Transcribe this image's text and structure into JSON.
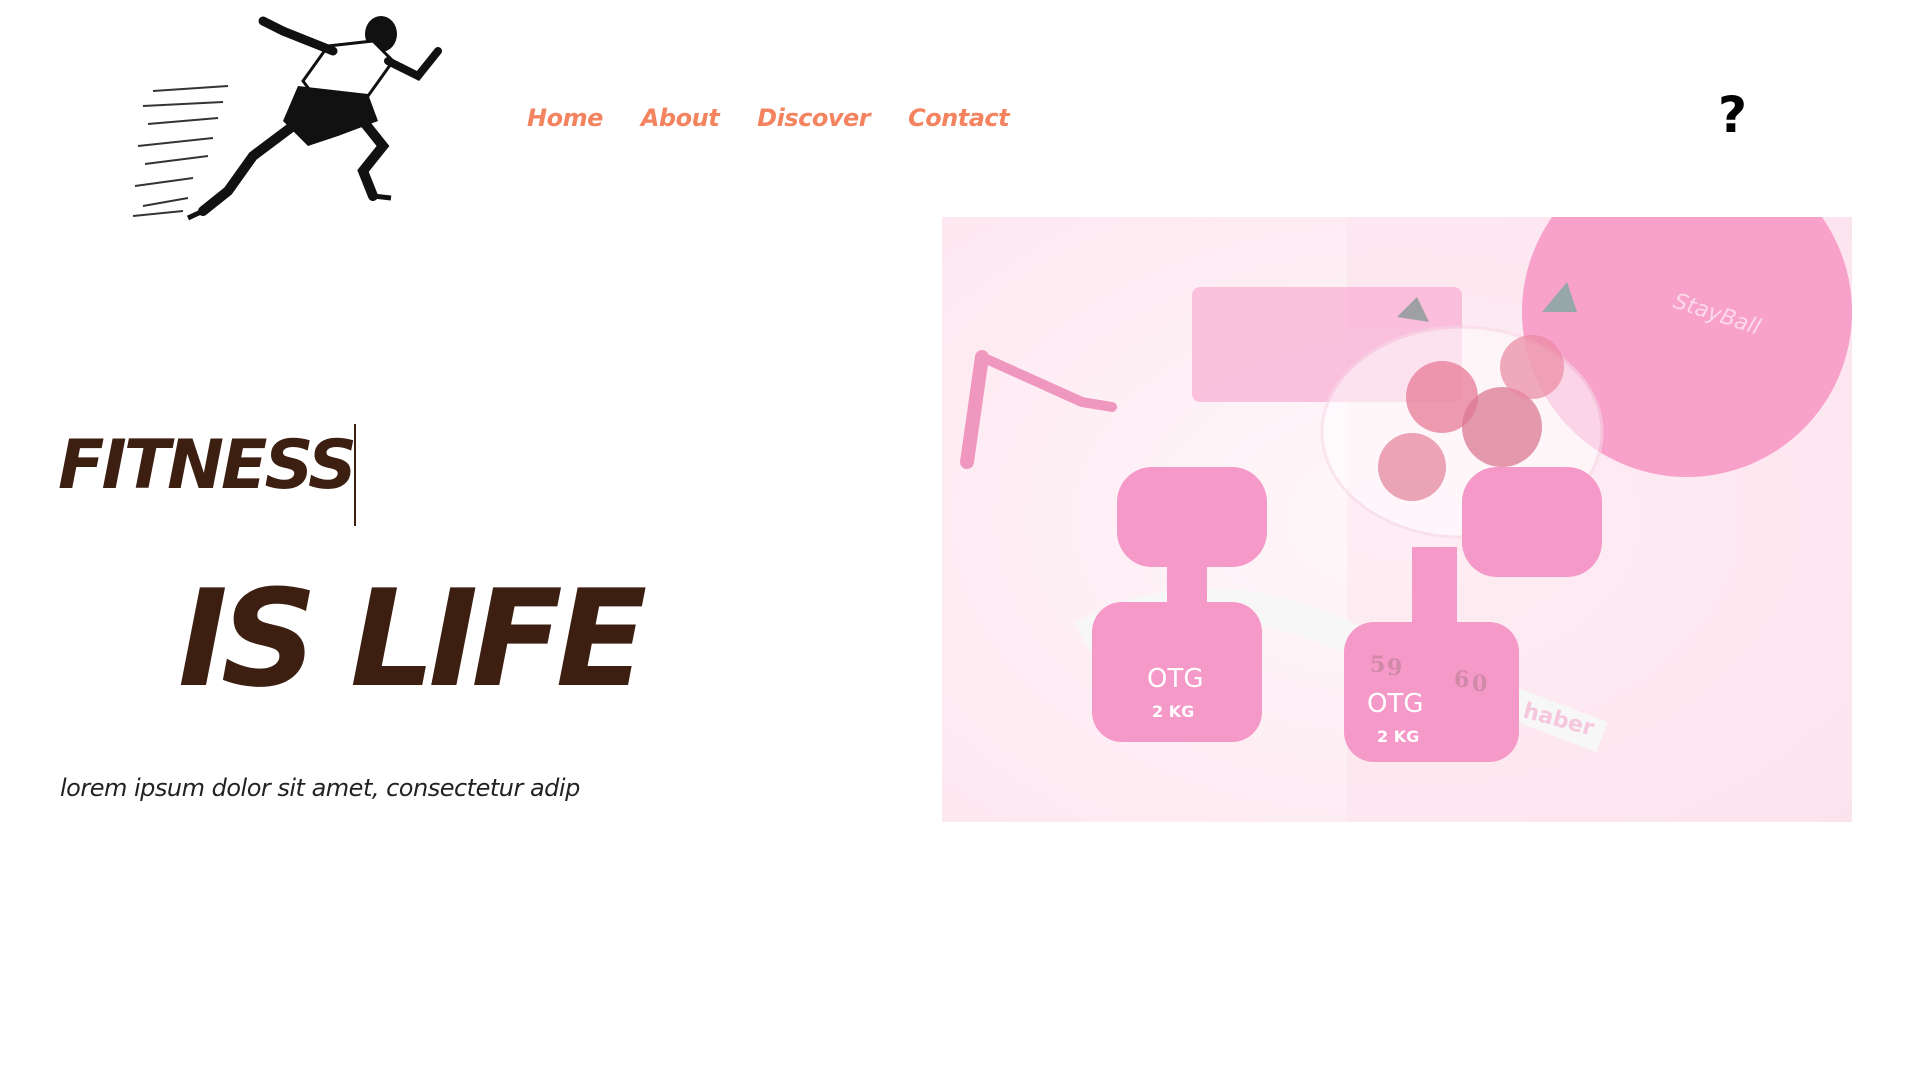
{
  "logo": {
    "icon": "sprinter-logo",
    "alt": "running man"
  },
  "nav": {
    "items": [
      {
        "label": "Home"
      },
      {
        "label": "About"
      },
      {
        "label": "Discover"
      },
      {
        "label": "Contact"
      }
    ],
    "color": "#f4845f"
  },
  "help": {
    "label": "?"
  },
  "hero": {
    "title_line1": "FITNESS",
    "title_line2": "IS LIFE",
    "subtitle": "lorem ipsum dolor sit amet, consectetur adip",
    "title_color": "#3d1f12"
  },
  "image": {
    "icon": "dumbbells-photo",
    "dumbbell_label": "2 KG",
    "tape_numbers": [
      "5",
      "9",
      "6",
      "0"
    ],
    "tape_brand": "haber",
    "ball_brand": "StayBall",
    "brand_logo": "OTG",
    "accent": "#f06aa6"
  }
}
